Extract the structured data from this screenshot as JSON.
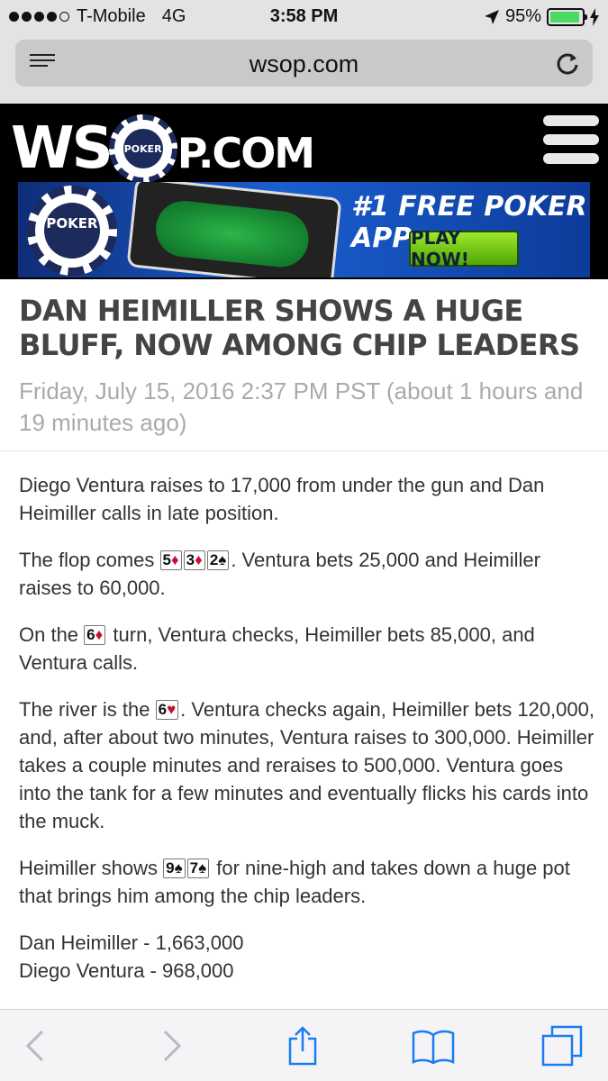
{
  "status_bar": {
    "carrier": "T-Mobile",
    "network": "4G",
    "time": "3:58 PM",
    "battery": "95%",
    "battery_level": 0.95,
    "signal_bars_filled": 4,
    "signal_bars_total": 5
  },
  "browser": {
    "domain": "wsop.com"
  },
  "site": {
    "logo_left": "WS",
    "logo_chip": "POKER",
    "logo_right": "P.COM",
    "banner": {
      "chip_label": "POKER",
      "headline": "#1 FREE POKER APP",
      "cta": "PLAY NOW!"
    }
  },
  "article": {
    "title": "DAN HEIMILLER SHOWS A HUGE BLUFF, NOW AMONG CHIP LEADERS",
    "dateline": "Friday, July 15, 2016 2:37 PM PST (about 1 hours and 19 minutes ago)",
    "p1": "Diego Ventura raises to 17,000 from under the gun and Dan Heimiller calls in late position.",
    "p2_before": "The flop comes ",
    "p2_after": ". Ventura bets 25,000 and Heimiller raises to 60,000.",
    "flop": [
      {
        "rank": "5",
        "suit": "♦",
        "color": "red"
      },
      {
        "rank": "3",
        "suit": "♦",
        "color": "red"
      },
      {
        "rank": "2",
        "suit": "♠",
        "color": "black"
      }
    ],
    "p3_before": "On the ",
    "p3_after": " turn, Ventura checks, Heimiller bets 85,000, and Ventura calls.",
    "turn": {
      "rank": "6",
      "suit": "♦",
      "color": "red"
    },
    "p4_before": "The river is the ",
    "p4_after": ". Ventura checks again, Heimiller bets 120,000, and, after about two minutes, Ventura raises to 300,000. Heimiller takes a couple minutes and reraises to 500,000. Ventura goes into the tank for a few minutes and eventually flicks his cards into the muck.",
    "river": {
      "rank": "6",
      "suit": "♥",
      "color": "red"
    },
    "p5_before": "Heimiller shows ",
    "p5_after": " for nine-high and takes down a huge pot that brings him among the chip leaders.",
    "shown": [
      {
        "rank": "9",
        "suit": "♠",
        "color": "black"
      },
      {
        "rank": "7",
        "suit": "♠",
        "color": "black"
      }
    ],
    "counts": [
      "Dan Heimiller - 1,663,000",
      "Diego Ventura - 968,000"
    ]
  },
  "toolbar": {
    "icons": [
      "back-icon",
      "forward-icon",
      "share-icon",
      "bookmarks-icon",
      "tabs-icon"
    ]
  },
  "colors": {
    "battery_green": "#4cd964",
    "ios_blue": "#1a7cf5",
    "card_red": "#c8102e",
    "header_black": "#000000"
  }
}
